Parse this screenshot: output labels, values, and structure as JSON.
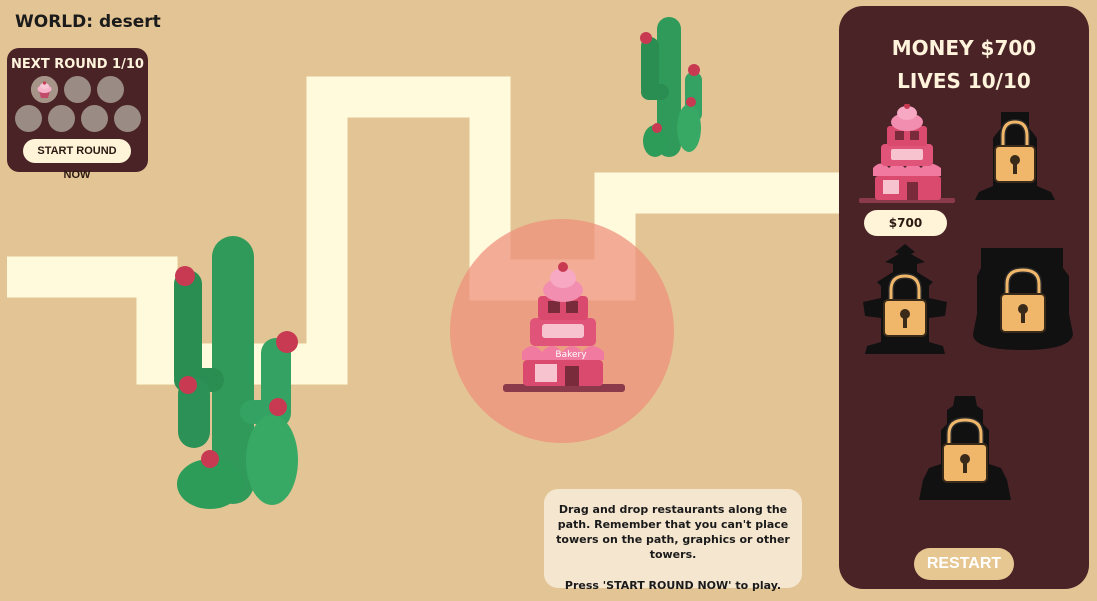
{
  "world": {
    "label": "WORLD: desert"
  },
  "round_panel": {
    "title": "NEXT ROUND 1/10",
    "current": 1,
    "total": 10,
    "enemy_icon": "cupcake-icon",
    "start_button_label": "START ROUND NOW"
  },
  "side_panel": {
    "money_label": "MONEY $700",
    "lives_label": "LIVES 10/10",
    "towers": [
      {
        "name": "bakery",
        "icon": "bakery-icon",
        "locked": false,
        "price": "$700"
      },
      {
        "name": "locked-tower-2",
        "icon": "lock-icon",
        "locked": true
      },
      {
        "name": "locked-tower-3",
        "icon": "lock-icon",
        "locked": true
      },
      {
        "name": "locked-tower-4",
        "icon": "lock-icon",
        "locked": true
      },
      {
        "name": "locked-tower-5",
        "icon": "lock-icon",
        "locked": true
      }
    ],
    "restart_label": "RESTART"
  },
  "map": {
    "placed_tower": {
      "type": "bakery",
      "sign": "Bakery"
    },
    "range_color": "#ee8f7c"
  },
  "help": {
    "line1": "Drag and drop restaurants along the path. Remember that you can't place towers on the path, graphics or other towers.",
    "line2": "Press 'START ROUND NOW' to play."
  },
  "colors": {
    "background": "#e3c595",
    "path": "#fffadb",
    "panel": "#4a2327",
    "lock": "#f0b76b",
    "pink": "#e3577a"
  }
}
